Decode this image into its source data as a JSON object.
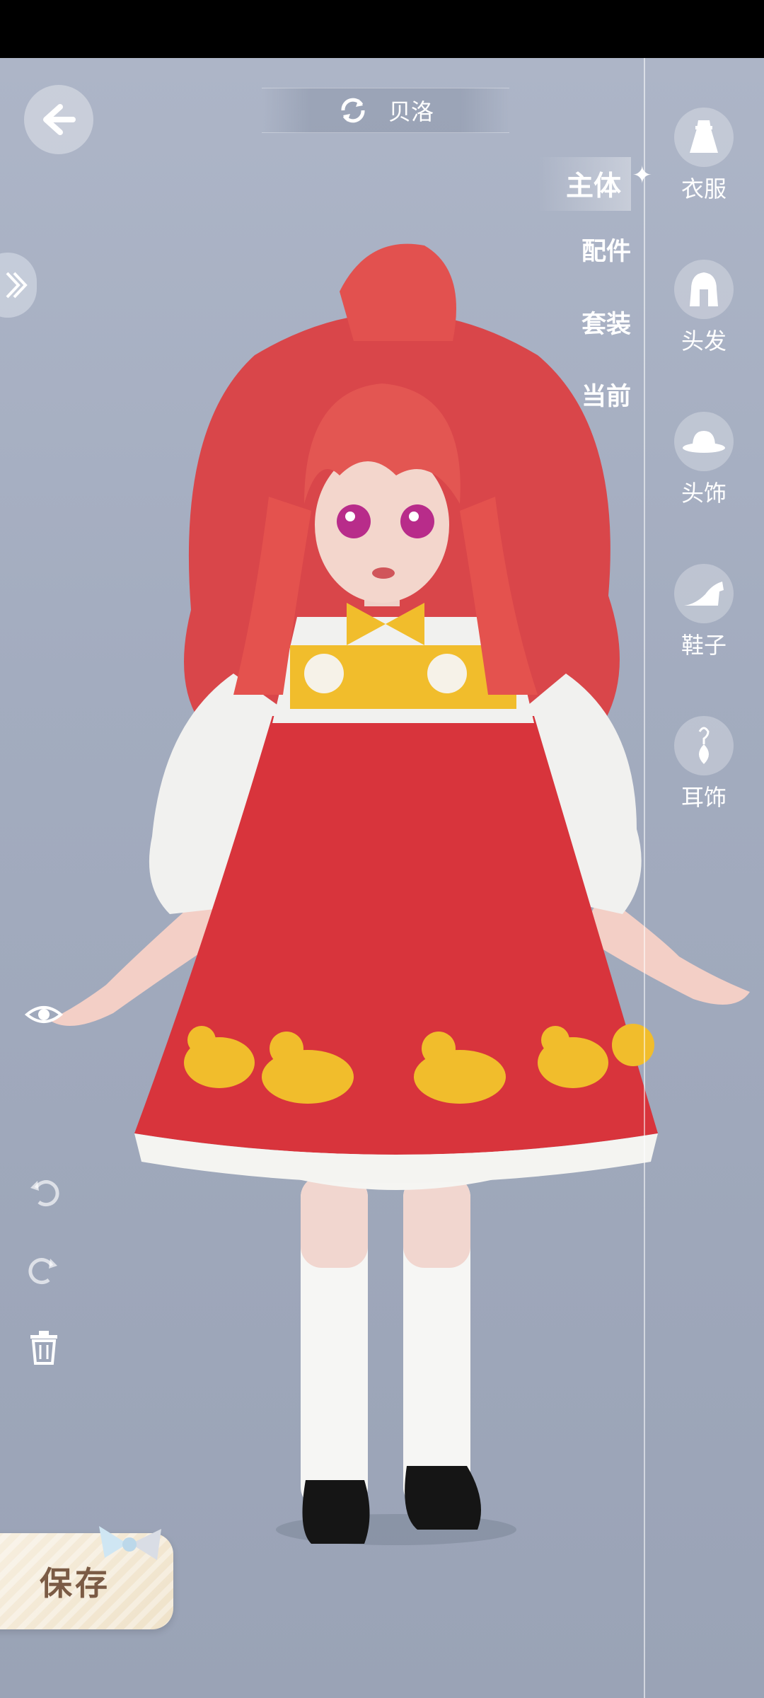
{
  "character": {
    "name": "贝洛"
  },
  "sub_tabs": [
    {
      "label": "主体",
      "active": true
    },
    {
      "label": "配件",
      "active": false
    },
    {
      "label": "套装",
      "active": false
    },
    {
      "label": "当前",
      "active": false
    }
  ],
  "categories": [
    {
      "label": "衣服",
      "icon": "dress-icon"
    },
    {
      "label": "头发",
      "icon": "hair-icon"
    },
    {
      "label": "头饰",
      "icon": "hat-icon"
    },
    {
      "label": "鞋子",
      "icon": "high-heel-icon"
    },
    {
      "label": "耳饰",
      "icon": "earring-icon"
    }
  ],
  "actions": {
    "save_label": "保存"
  },
  "colors": {
    "dress_red": "#d8343c",
    "duck_yellow": "#f1bd2c",
    "hair": "#e4524e"
  }
}
